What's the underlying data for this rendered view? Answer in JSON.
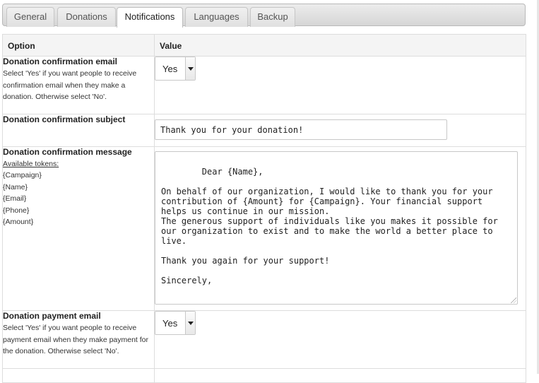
{
  "tabs": [
    {
      "label": "General",
      "active": false
    },
    {
      "label": "Donations",
      "active": false
    },
    {
      "label": "Notifications",
      "active": true
    },
    {
      "label": "Languages",
      "active": false
    },
    {
      "label": "Backup",
      "active": false
    }
  ],
  "table": {
    "header_option": "Option",
    "header_value": "Value"
  },
  "rows": {
    "confirmation_email": {
      "title": "Donation confirmation email",
      "description": "Select 'Yes' if you want people to receive confirmation email when they make a donation. Otherwise select 'No'.",
      "value": "Yes"
    },
    "confirmation_subject": {
      "title": "Donation confirmation subject",
      "value": "Thank you for your donation!"
    },
    "confirmation_message": {
      "title": "Donation confirmation message",
      "tokens_label": "Available tokens:",
      "tokens": [
        "{Campaign}",
        "{Name}",
        "{Email}",
        "{Phone}",
        "{Amount}"
      ],
      "value": "Dear {Name},\n\nOn behalf of our organization, I would like to thank you for your contribution of {Amount} for {Campaign}. Your financial support helps us continue in our mission.\nThe generous support of individuals like you makes it possible for our organization to exist and to make the world a better place to live.\n\nThank you again for your support!\n\nSincerely,"
    },
    "payment_email": {
      "title": "Donation payment email",
      "description": "Select 'Yes' if you want people to receive payment email when they make payment for the donation. Otherwise select 'No'.",
      "value": "Yes"
    }
  }
}
